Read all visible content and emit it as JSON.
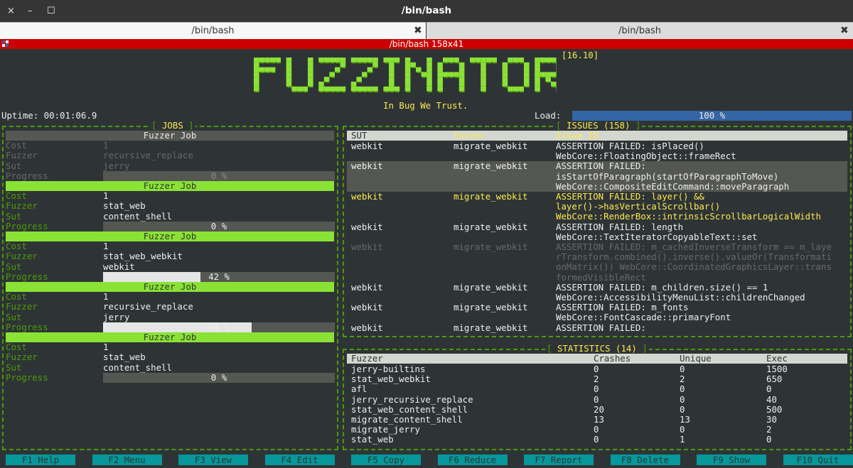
{
  "window": {
    "title": "/bin/bash",
    "close_glyph": "×",
    "minimize_glyph": "–",
    "maximize_glyph": "☐"
  },
  "tabs": [
    {
      "label": "/bin/bash",
      "close_glyph": "✖"
    },
    {
      "label": "/bin/bash",
      "close_glyph": "✖"
    }
  ],
  "terminal_bar": {
    "title": "/bin/bash 158x41"
  },
  "app": {
    "logo_text": "FUZZINATOR",
    "version": "[16.10]",
    "tagline": "In Bug We Trust.",
    "uptime": "Uptime: 00:01:06.9",
    "load_label": "Load:",
    "load_value": "100 %",
    "load_fraction": 1.0
  },
  "jobs": {
    "title": "JOBS",
    "header_label": "Fuzzer Job",
    "field_labels": {
      "cost": "Cost",
      "fuzzer": "Fuzzer",
      "sut": "Sut",
      "progress": "Progress"
    },
    "items": [
      {
        "cost": "1",
        "fuzzer": "recursive_replace",
        "sut": "jerry",
        "progress_text": "0 %",
        "progress": 0,
        "active": false
      },
      {
        "cost": "1",
        "fuzzer": "stat_web",
        "sut": "content_shell",
        "progress_text": "0 %",
        "progress": 0,
        "active": true
      },
      {
        "cost": "1",
        "fuzzer": "stat_web_webkit",
        "sut": "webkit",
        "progress_text": "42 %",
        "progress": 0.42,
        "active": true
      },
      {
        "cost": "1",
        "fuzzer": "recursive_replace",
        "sut": "jerry",
        "progress_text": "64 %",
        "progress": 0.64,
        "active": true
      },
      {
        "cost": "1",
        "fuzzer": "stat_web",
        "sut": "content_shell",
        "progress_text": "0 %",
        "progress": 0,
        "active": true
      }
    ]
  },
  "issues": {
    "title": "ISSUES (158)",
    "columns": [
      "SUT",
      "Fuzzer",
      "Issue ID"
    ],
    "rows": [
      {
        "sut": "webkit",
        "fuzzer": "migrate_webkit",
        "lines": [
          "ASSERTION FAILED: isPlaced()",
          "WebCore::FloatingObject::frameRect"
        ],
        "style": "normal"
      },
      {
        "sut": "webkit",
        "fuzzer": "migrate_webkit",
        "lines": [
          "ASSERTION FAILED:",
          "isStartOfParagraph(startOfParagraphToMove)",
          "WebCore::CompositeEditCommand::moveParagraph"
        ],
        "style": "selected"
      },
      {
        "sut": "webkit",
        "fuzzer": "migrate_webkit",
        "lines": [
          "ASSERTION FAILED: layer() &&",
          "layer()->hasVerticalScrollbar()",
          "WebCore::RenderBox::intrinsicScrollbarLogicalWidth"
        ],
        "style": "yellow"
      },
      {
        "sut": "webkit",
        "fuzzer": "migrate_webkit",
        "lines": [
          "ASSERTION FAILED: length",
          "WebCore::TextIteratorCopyableText::set"
        ],
        "style": "normal"
      },
      {
        "sut": "webkit",
        "fuzzer": "migrate_webkit",
        "lines": [
          "ASSERTION FAILED: m_cachedInverseTransform == m_laye",
          "rTransform.combined().inverse().valueOr(Transformati",
          "onMatrix()) WebCore::CoordinatedGraphicsLayer::trans",
          "formedVisibleRect"
        ],
        "style": "dim"
      },
      {
        "sut": "webkit",
        "fuzzer": "migrate_webkit",
        "lines": [
          "ASSERTION FAILED: m_children.size() == 1",
          "WebCore::AccessibilityMenuList::childrenChanged"
        ],
        "style": "normal"
      },
      {
        "sut": "webkit",
        "fuzzer": "migrate_webkit",
        "lines": [
          "ASSERTION FAILED: m_fonts",
          "WebCore::FontCascade::primaryFont"
        ],
        "style": "normal"
      },
      {
        "sut": "webkit",
        "fuzzer": "migrate_webkit",
        "lines": [
          "ASSERTION FAILED:"
        ],
        "style": "normal"
      }
    ]
  },
  "statistics": {
    "title": "STATISTICS (14)",
    "columns": [
      "Fuzzer",
      "Crashes",
      "Unique",
      "Exec"
    ],
    "rows": [
      [
        "jerry-builtins",
        "0",
        "0",
        "1500"
      ],
      [
        "stat_web_webkit",
        "2",
        "2",
        "650"
      ],
      [
        "afl",
        "0",
        "0",
        "0"
      ],
      [
        "jerry_recursive_replace",
        "0",
        "0",
        "40"
      ],
      [
        "stat_web_content_shell",
        "20",
        "0",
        "500"
      ],
      [
        "migrate_content_shell",
        "13",
        "13",
        "30"
      ],
      [
        "migrate_jerry",
        "0",
        "0",
        "2"
      ],
      [
        "stat_web",
        "0",
        "1",
        "0"
      ]
    ]
  },
  "function_keys": [
    "F1 Help",
    "F2 Menu",
    "F3 View",
    "F4 Edit",
    "F5 Copy",
    "F6 Reduce",
    "F7 Report",
    "F8 Delete",
    "F9 Show",
    "F10 Quit"
  ],
  "colors": {
    "terminal_bg": "#2e3436",
    "accent_green": "#8ae234",
    "frame_green": "#4e9a06",
    "title_yellow": "#fce94f",
    "load_blue": "#3465a4",
    "fkey_teal": "#06989a",
    "tab_red": "#cc0000"
  }
}
